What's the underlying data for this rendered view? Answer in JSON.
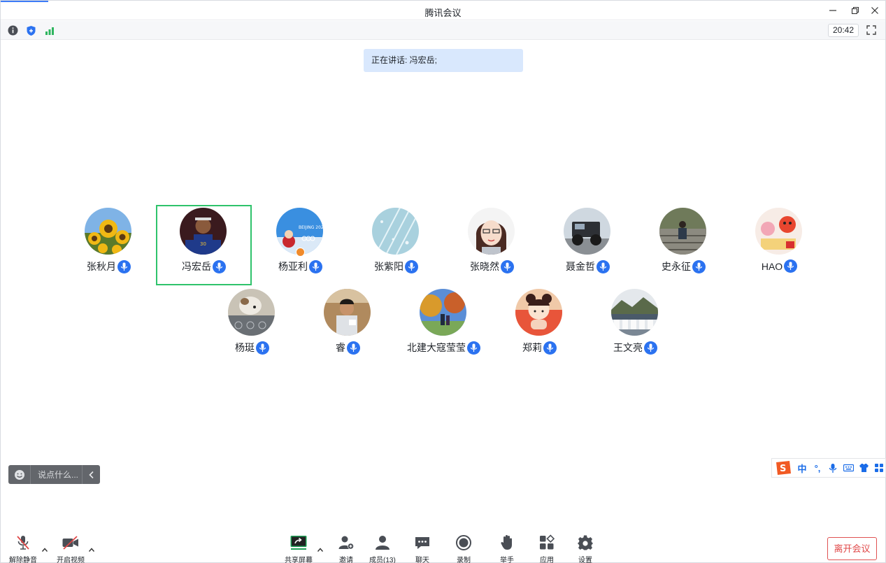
{
  "window": {
    "title": "腾讯会议"
  },
  "status": {
    "time": "20:42"
  },
  "banner": {
    "speaking": "正在讲话: 冯宏岳;"
  },
  "participants": [
    {
      "name": "张秋月"
    },
    {
      "name": "冯宏岳"
    },
    {
      "name": "杨亚利"
    },
    {
      "name": "张紫阳"
    },
    {
      "name": "张晓然"
    },
    {
      "name": "聂金哲"
    },
    {
      "name": "史永征"
    },
    {
      "name": "HAO"
    },
    {
      "name": "杨珽"
    },
    {
      "name": "睿"
    },
    {
      "name": "北建大寇莹莹"
    },
    {
      "name": "郑莉"
    },
    {
      "name": "王文亮"
    }
  ],
  "chat": {
    "placeholder": "说点什么..."
  },
  "ime": {
    "lang": "中",
    "punct": "°,"
  },
  "toolbar": {
    "unmute": "解除静音",
    "video": "开启视频",
    "share": "共享屏幕",
    "invite": "邀请",
    "members": "成员(13)",
    "chat": "聊天",
    "record": "录制",
    "raise_hand": "举手",
    "apps": "应用",
    "settings": "设置",
    "leave": "离开会议"
  },
  "colors": {
    "accent": "#2b72f0",
    "speaker_border": "#2fc36b",
    "leave": "#e04848",
    "banner_bg": "#d9e8fd"
  }
}
